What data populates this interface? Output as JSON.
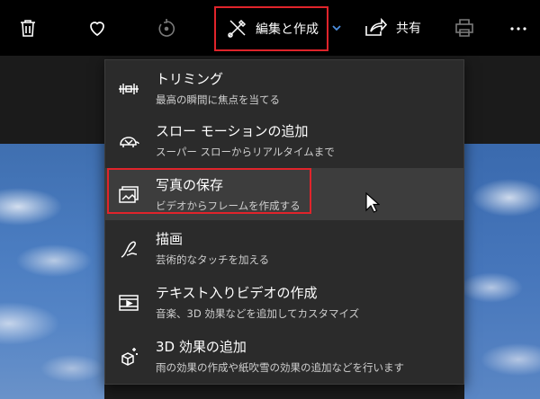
{
  "toolbar": {
    "delete_icon": "trash-icon",
    "favorite_icon": "heart-icon",
    "rotate_icon": "rotate-icon",
    "edit_create_label": "編集と作成",
    "share_label": "共有",
    "print_icon": "printer-icon",
    "more_icon": "ellipsis-icon"
  },
  "menu": {
    "items": [
      {
        "icon": "trim-icon",
        "title": "トリミング",
        "subtitle": "最高の瞬間に焦点を当てる"
      },
      {
        "icon": "turtle-icon",
        "title": "スロー モーションの追加",
        "subtitle": "スーパー スローからリアルタイムまで"
      },
      {
        "icon": "save-frame-icon",
        "title": "写真の保存",
        "subtitle": "ビデオからフレームを作成する"
      },
      {
        "icon": "draw-icon",
        "title": "描画",
        "subtitle": "芸術的なタッチを加える"
      },
      {
        "icon": "text-video-icon",
        "title": "テキスト入りビデオの作成",
        "subtitle": "音楽、3D 効果などを追加してカスタマイズ"
      },
      {
        "icon": "effects-3d-icon",
        "title": "3D 効果の追加",
        "subtitle": "雨の効果の作成や紙吹雪の効果の追加などを行います"
      }
    ]
  },
  "colors": {
    "highlight": "#e0242b",
    "menu_bg": "#2b2b2b",
    "toolbar_bg": "#000000"
  }
}
